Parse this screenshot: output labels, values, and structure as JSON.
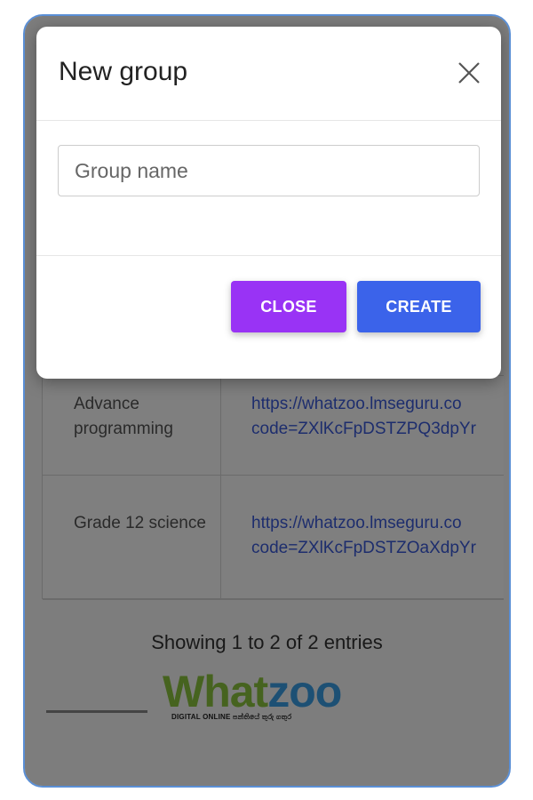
{
  "modal": {
    "title": "New group",
    "input_placeholder": "Group name",
    "input_value": "",
    "close_button_label": "CLOSE",
    "create_button_label": "CREATE",
    "dismiss_icon": "close-icon"
  },
  "table": {
    "rows": [
      {
        "name": "Advance programming",
        "link_line1": "https://whatzoo.lmseguru.co",
        "link_line2": "code=ZXlKcFpDSTZPQ3dpYr"
      },
      {
        "name": "Grade 12 science",
        "link_line1": "https://whatzoo.lmseguru.co",
        "link_line2": "code=ZXlKcFpDSTZOaXdpYr"
      }
    ]
  },
  "pagination": {
    "entries_text": "Showing 1 to 2 of 2 entries"
  },
  "watermark": {
    "word_part1": "What",
    "word_part2": "zoo",
    "tagline": "DIGITAL ONLINE පන්තියේ තුරු ගතුර"
  },
  "colors": {
    "close_button": "#9933f5",
    "create_button": "#3b63ea",
    "link": "#3b5bdb",
    "logo_green": "#8dc63f",
    "logo_blue": "#3aa0e8"
  }
}
